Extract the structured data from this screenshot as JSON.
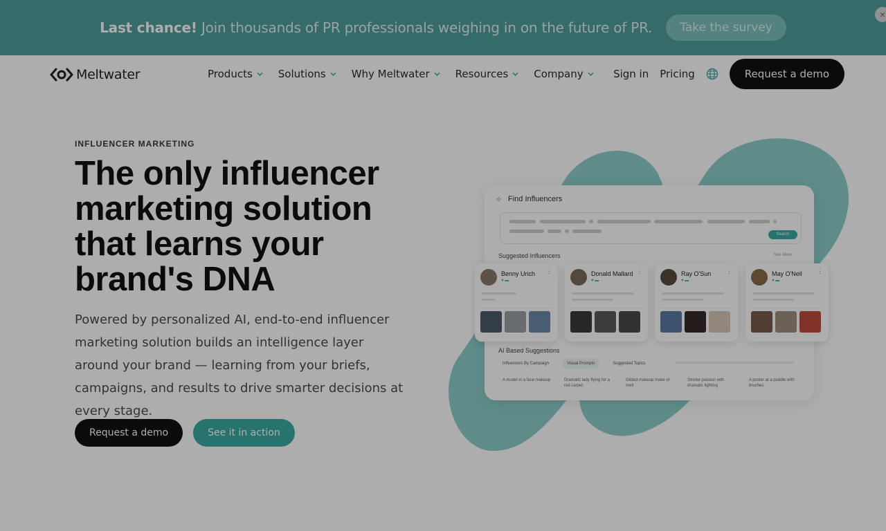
{
  "banner": {
    "bold": "Last chance!",
    "text": " Join thousands of PR professionals weighing in on the future of PR.",
    "button": "Take the survey",
    "close": "×"
  },
  "nav": {
    "logo": "Meltwater",
    "items": [
      "Products",
      "Solutions",
      "Why Meltwater",
      "Resources",
      "Company"
    ],
    "sign_in": "Sign in",
    "pricing": "Pricing",
    "demo": "Request a demo"
  },
  "hero": {
    "eyebrow": "INFLUENCER MARKETING",
    "headline": "The only influencer marketing solution that learns your brand's DNA",
    "subcopy": "Powered by personalized AI, end-to-end influencer marketing solution builds an intelligence layer around your brand — learning from your briefs, campaigns, and results to drive smarter decisions at every stage.",
    "cta_primary": "Request a demo",
    "cta_secondary": "See it in action"
  },
  "illustration": {
    "panel_title": "Find Influencers",
    "search_button": "Search",
    "suggested_label": "Suggested Influencers",
    "see_more": "See More",
    "influencers": [
      {
        "name": "Benny Urich"
      },
      {
        "name": "Donald Mallard"
      },
      {
        "name": "Ray O'Sun"
      },
      {
        "name": "May O'Neil"
      }
    ],
    "ai_label": "AI Based Suggestions",
    "tabs": [
      "Influencers By Campaign",
      "Visual Prompts",
      "Suggested Topics"
    ],
    "suggestions": [
      "A model in a face makeup",
      "Dramatic lady flying for a red carpet",
      "Gilded makeup make or melt",
      "Smoke passion with dramatic lighting",
      "A poster at a puddle with brushes"
    ]
  },
  "colors": {
    "banner_bg": "#4f9f9c",
    "accent": "#3aaaa3",
    "dark": "#111111"
  }
}
